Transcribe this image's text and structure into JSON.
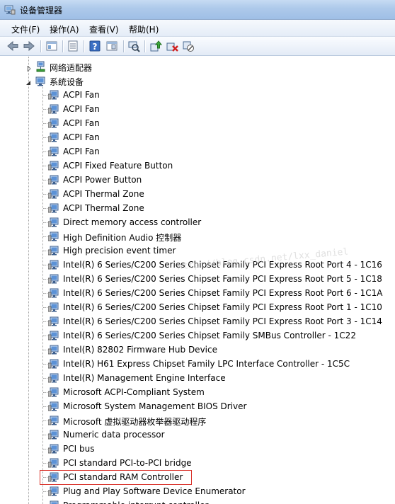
{
  "window": {
    "title": "设备管理器"
  },
  "menu": [
    "文件(F)",
    "操作(A)",
    "查看(V)",
    "帮助(H)"
  ],
  "toolbar_buttons": [
    "back-icon",
    "forward-icon",
    "properties-view-icon",
    "list-view-icon",
    "help-icon",
    "view-panel-icon",
    "scan-hardware-icon",
    "update-driver-icon",
    "uninstall-icon",
    "disable-icon"
  ],
  "tree": {
    "network_adapters": "网络适配器",
    "system_devices": "系统设备",
    "devices": [
      "ACPI Fan",
      "ACPI Fan",
      "ACPI Fan",
      "ACPI Fan",
      "ACPI Fan",
      "ACPI Fixed Feature Button",
      "ACPI Power Button",
      "ACPI Thermal Zone",
      "ACPI Thermal Zone",
      "Direct memory access controller",
      "High Definition Audio 控制器",
      "High precision event timer",
      "Intel(R) 6 Series/C200 Series Chipset Family PCI Express Root Port 4 - 1C16",
      "Intel(R) 6 Series/C200 Series Chipset Family PCI Express Root Port 5 - 1C18",
      "Intel(R) 6 Series/C200 Series Chipset Family PCI Express Root Port 6 - 1C1A",
      "Intel(R) 6 Series/C200 Series Chipset Family PCI Express Root Port 1 - 1C10",
      "Intel(R) 6 Series/C200 Series Chipset Family PCI Express Root Port 3 - 1C14",
      "Intel(R) 6 Series/C200 Series Chipset Family SMBus Controller - 1C22",
      "Intel(R) 82802 Firmware Hub Device",
      "Intel(R) H61 Express Chipset Family LPC Interface Controller - 1C5C",
      "Intel(R) Management Engine Interface",
      "Microsoft ACPI-Compliant System",
      "Microsoft System Management BIOS Driver",
      "Microsoft 虚拟驱动器枚举器驱动程序",
      "Numeric data processor",
      "PCI bus",
      "PCI standard PCI-to-PCI bridge",
      "PCI standard RAM Controller",
      "Plug and Play Software Device Enumerator",
      "Programmable interrupt controller"
    ],
    "highlighted": "PCI standard RAM Controller"
  },
  "watermark": "http://blog.csdn.net/lxx_daniel",
  "colors": {
    "highlight_border": "#d9322b",
    "title_bar": "#adc9ea"
  }
}
